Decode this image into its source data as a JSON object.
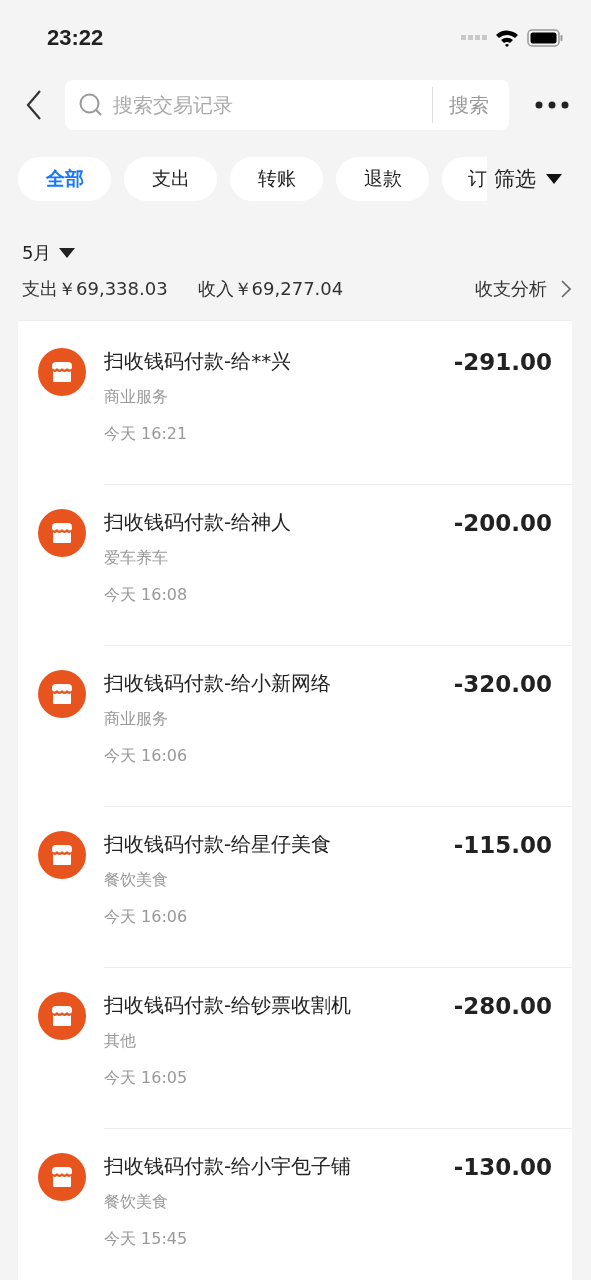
{
  "status_bar": {
    "time": "23:22"
  },
  "search": {
    "placeholder": "搜索交易记录",
    "button": "搜索"
  },
  "chips": [
    {
      "label": "全部",
      "selected": true
    },
    {
      "label": "支出",
      "selected": false
    },
    {
      "label": "转账",
      "selected": false
    },
    {
      "label": "退款",
      "selected": false
    },
    {
      "label": "订",
      "selected": false
    }
  ],
  "filter": "筛选",
  "month": "5月",
  "summary": {
    "expense": "支出￥69,338.03",
    "income": "收入￥69,277.04",
    "analysis": "收支分析"
  },
  "transactions": [
    {
      "title": "扫收钱码付款-给**兴",
      "category": "商业服务",
      "time": "今天 16:21",
      "amount": "-291.00"
    },
    {
      "title": "扫收钱码付款-给神人",
      "category": "爱车养车",
      "time": "今天 16:08",
      "amount": "-200.00"
    },
    {
      "title": "扫收钱码付款-给小新网络",
      "category": "商业服务",
      "time": "今天 16:06",
      "amount": "-320.00"
    },
    {
      "title": "扫收钱码付款-给星仔美食",
      "category": "餐饮美食",
      "time": "今天 16:06",
      "amount": "-115.00"
    },
    {
      "title": "扫收钱码付款-给钞票收割机",
      "category": "其他",
      "time": "今天 16:05",
      "amount": "-280.00"
    },
    {
      "title": "扫收钱码付款-给小宇包子铺",
      "category": "餐饮美食",
      "time": "今天 15:45",
      "amount": "-130.00"
    }
  ]
}
